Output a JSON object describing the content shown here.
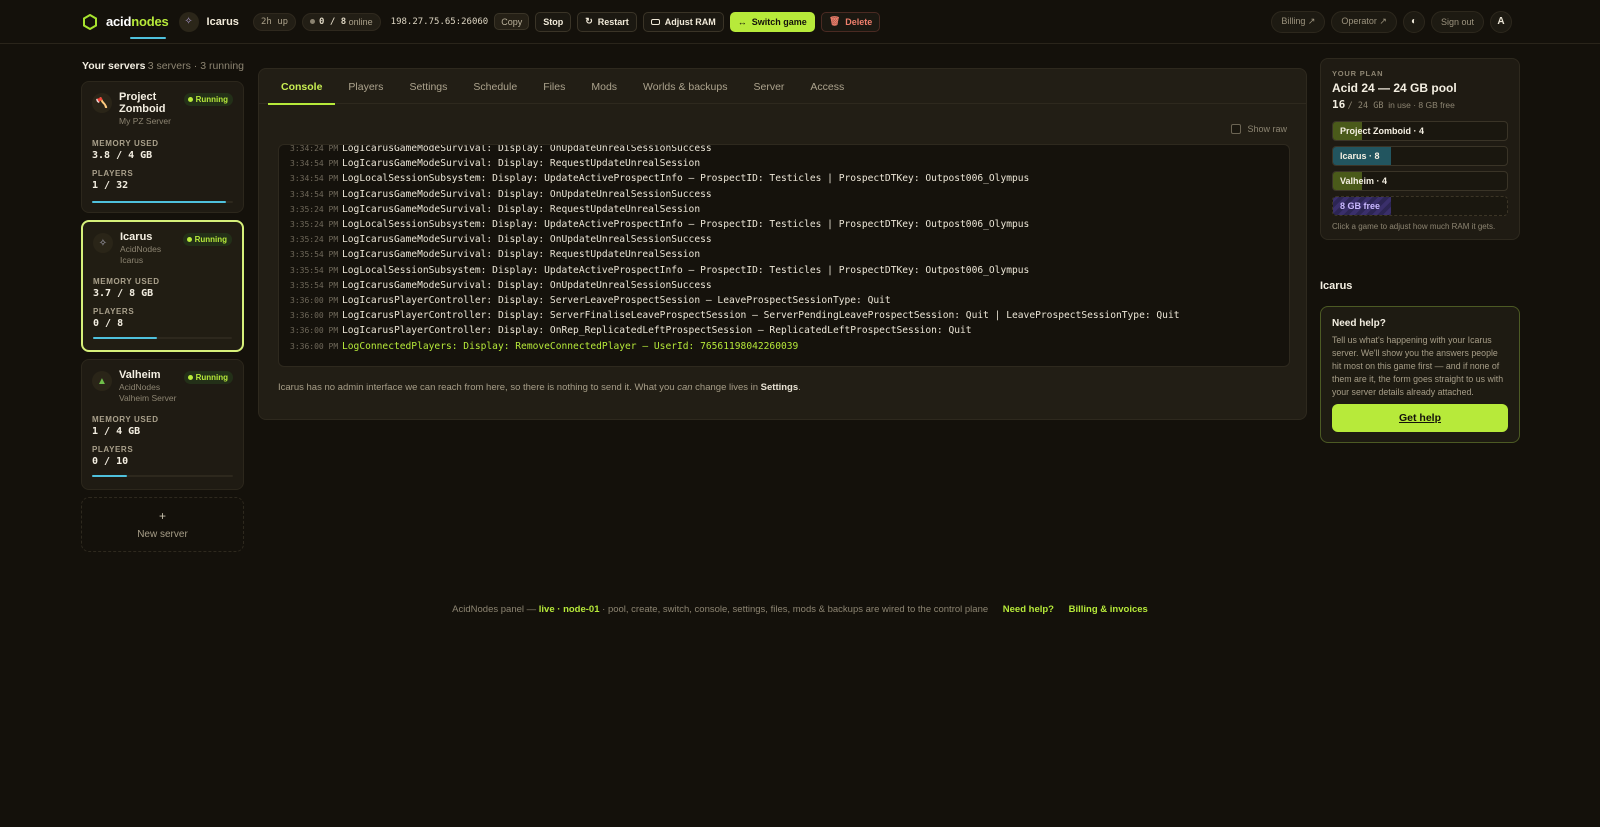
{
  "brand": {
    "name_a": "acid",
    "name_b": "nodes",
    "accent": "#b7ea3a"
  },
  "topbar": {
    "server_name": "Icarus",
    "uptime": "2h up",
    "online": "0 / 8",
    "online_label": "online",
    "ip": "198.27.75.65:26060",
    "copy": "Copy",
    "stop": "Stop",
    "restart": "Restart",
    "adjust_ram": "Adjust RAM",
    "switch_game": "Switch game",
    "delete": "Delete",
    "billing": "Billing ↗",
    "operator": "Operator ↗",
    "signout": "Sign out",
    "avatar": "A"
  },
  "sidebar": {
    "title": "Your servers",
    "summary": "3 servers · 3 running",
    "memory_label": "MEMORY USED",
    "players_label": "PLAYERS",
    "new_server": "New server",
    "servers": [
      {
        "name": "Project Zomboid",
        "line1": "My PZ Server",
        "line2": "",
        "status": "Running",
        "memory": "3.8 / 4 GB",
        "players": "1 / 32",
        "memory_fraction": 0.95,
        "icon": "axe-icon"
      },
      {
        "name": "Icarus",
        "line1": "AcidNodes",
        "line2": "Icarus",
        "status": "Running",
        "memory": "3.7 / 8 GB",
        "players": "0 / 8",
        "memory_fraction": 0.46,
        "icon": "planet-icon"
      },
      {
        "name": "Valheim",
        "line1": "AcidNodes",
        "line2": "Valheim Server",
        "status": "Running",
        "memory": "1 / 4 GB",
        "players": "0 / 10",
        "memory_fraction": 0.25,
        "icon": "tree-icon"
      }
    ]
  },
  "tabs": [
    "Console",
    "Players",
    "Settings",
    "Schedule",
    "Files",
    "Mods",
    "Worlds & backups",
    "Server",
    "Access"
  ],
  "console": {
    "show_raw": "Show raw",
    "lines": [
      {
        "ts": "3:34:24 PM",
        "msg": "LogIcarusGameModeSurvival: Display: OnUpdateUnrealSessionSuccess"
      },
      {
        "ts": "3:34:54 PM",
        "msg": "LogIcarusGameModeSurvival: Display: RequestUpdateUnrealSession"
      },
      {
        "ts": "3:34:54 PM",
        "msg": "LogLocalSessionSubsystem: Display: UpdateActiveProspectInfo – ProspectID: Testicles | ProspectDTKey: Outpost006_Olympus"
      },
      {
        "ts": "3:34:54 PM",
        "msg": "LogIcarusGameModeSurvival: Display: OnUpdateUnrealSessionSuccess"
      },
      {
        "ts": "3:35:24 PM",
        "msg": "LogIcarusGameModeSurvival: Display: RequestUpdateUnrealSession"
      },
      {
        "ts": "3:35:24 PM",
        "msg": "LogLocalSessionSubsystem: Display: UpdateActiveProspectInfo – ProspectID: Testicles | ProspectDTKey: Outpost006_Olympus"
      },
      {
        "ts": "3:35:24 PM",
        "msg": "LogIcarusGameModeSurvival: Display: OnUpdateUnrealSessionSuccess"
      },
      {
        "ts": "3:35:54 PM",
        "msg": "LogIcarusGameModeSurvival: Display: RequestUpdateUnrealSession"
      },
      {
        "ts": "3:35:54 PM",
        "msg": "LogLocalSessionSubsystem: Display: UpdateActiveProspectInfo – ProspectID: Testicles | ProspectDTKey: Outpost006_Olympus"
      },
      {
        "ts": "3:35:54 PM",
        "msg": "LogIcarusGameModeSurvival: Display: OnUpdateUnrealSessionSuccess"
      },
      {
        "ts": "3:36:00 PM",
        "msg": "LogIcarusPlayerController: Display: ServerLeaveProspectSession – LeaveProspectSessionType: Quit"
      },
      {
        "ts": "3:36:00 PM",
        "msg": "LogIcarusPlayerController: Display: ServerFinaliseLeaveProspectSession – ServerPendingLeaveProspectSession: Quit | LeaveProspectSessionType: Quit"
      },
      {
        "ts": "3:36:00 PM",
        "msg": "LogIcarusPlayerController: Display: OnRep_ReplicatedLeftProspectSession – ReplicatedLeftProspectSession: Quit"
      },
      {
        "ts": "3:36:00 PM",
        "msg": "LogConnectedPlayers: Display: RemoveConnectedPlayer – UserId: 76561198042260039",
        "highlight": true
      }
    ],
    "note_a": "Icarus has no admin interface we can reach from here, so there is nothing to send it. What you ",
    "note_b": "can",
    "note_c": " change lives in ",
    "note_d": "Settings",
    "note_e": "."
  },
  "plan": {
    "kicker": "YOUR PLAN",
    "title": "Acid 24 — 24 GB pool",
    "used": "16",
    "total": "/ 24 GB",
    "suffix": "in use · 8 GB free",
    "bars": [
      {
        "label": "Project Zomboid · 4",
        "fraction": 0.1667,
        "color": "#4a5a1a"
      },
      {
        "label": "Icarus · 8",
        "fraction": 0.3333,
        "color": "#22555f"
      },
      {
        "label": "Valheim · 4",
        "fraction": 0.1667,
        "color": "#4a5a1a"
      }
    ],
    "free": {
      "label": "8 GB free",
      "fraction": 0.3333
    },
    "hint": "Click a game to adjust how much RAM it gets."
  },
  "right": {
    "section": "Icarus",
    "help_title": "Need help?",
    "help_body": "Tell us what's happening with your Icarus server. We'll show you the answers people hit most on this game first — and if none of them are it, the form goes straight to us with your server details already attached.",
    "help_button": "Get help"
  },
  "footer": {
    "a": "AcidNodes panel — ",
    "live": "live · node-01",
    "b": " · pool, create, switch, console, settings, files, mods & backups are wired to the control plane",
    "help": "Need help?",
    "billing": "Billing & invoices"
  }
}
